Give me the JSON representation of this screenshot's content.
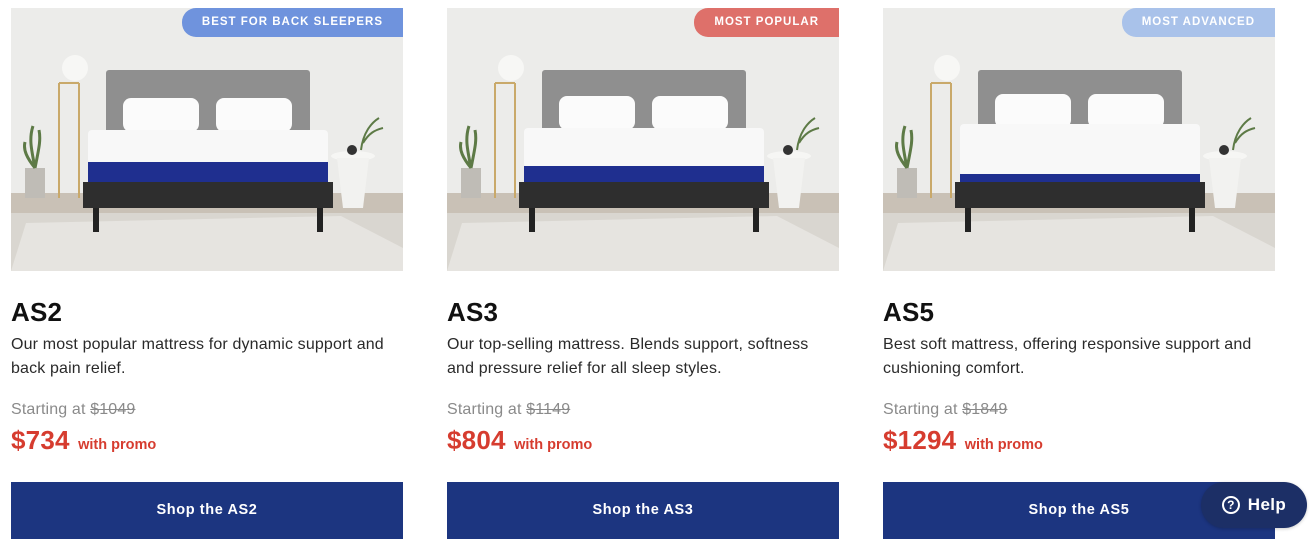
{
  "products": [
    {
      "badge": "BEST FOR BACK SLEEPERS",
      "badge_color": "#6f93dd",
      "name": "AS2",
      "description": "Our most popular mattress for dynamic support and back pain relief.",
      "starting_label": "Starting at",
      "original_price": "$1049",
      "promo_price": "$734",
      "promo_label": "with promo",
      "button_label": "Shop the AS2",
      "band_color": "#1f2f8f"
    },
    {
      "badge": "MOST POPULAR",
      "badge_color": "#de706a",
      "name": "AS3",
      "description": "Our top-selling mattress. Blends support, softness and pressure relief for all sleep styles.",
      "starting_label": "Starting at",
      "original_price": "$1149",
      "promo_price": "$804",
      "promo_label": "with promo",
      "button_label": "Shop the AS3",
      "band_color": "#1f2f8f"
    },
    {
      "badge": "MOST ADVANCED",
      "badge_color": "#a9c2ea",
      "name": "AS5",
      "description": "Best soft mattress, offering responsive support and cushioning comfort.",
      "starting_label": "Starting at",
      "original_price": "$1849",
      "promo_price": "$1294",
      "promo_label": "with promo",
      "button_label": "Shop the AS5",
      "band_color": "#1f2f8f"
    }
  ],
  "help": {
    "label": "Help",
    "icon": "question-circle-icon"
  },
  "colors": {
    "button_bg": "#1c3580",
    "price_red": "#d63c2f",
    "help_bg": "#1c2f66"
  }
}
